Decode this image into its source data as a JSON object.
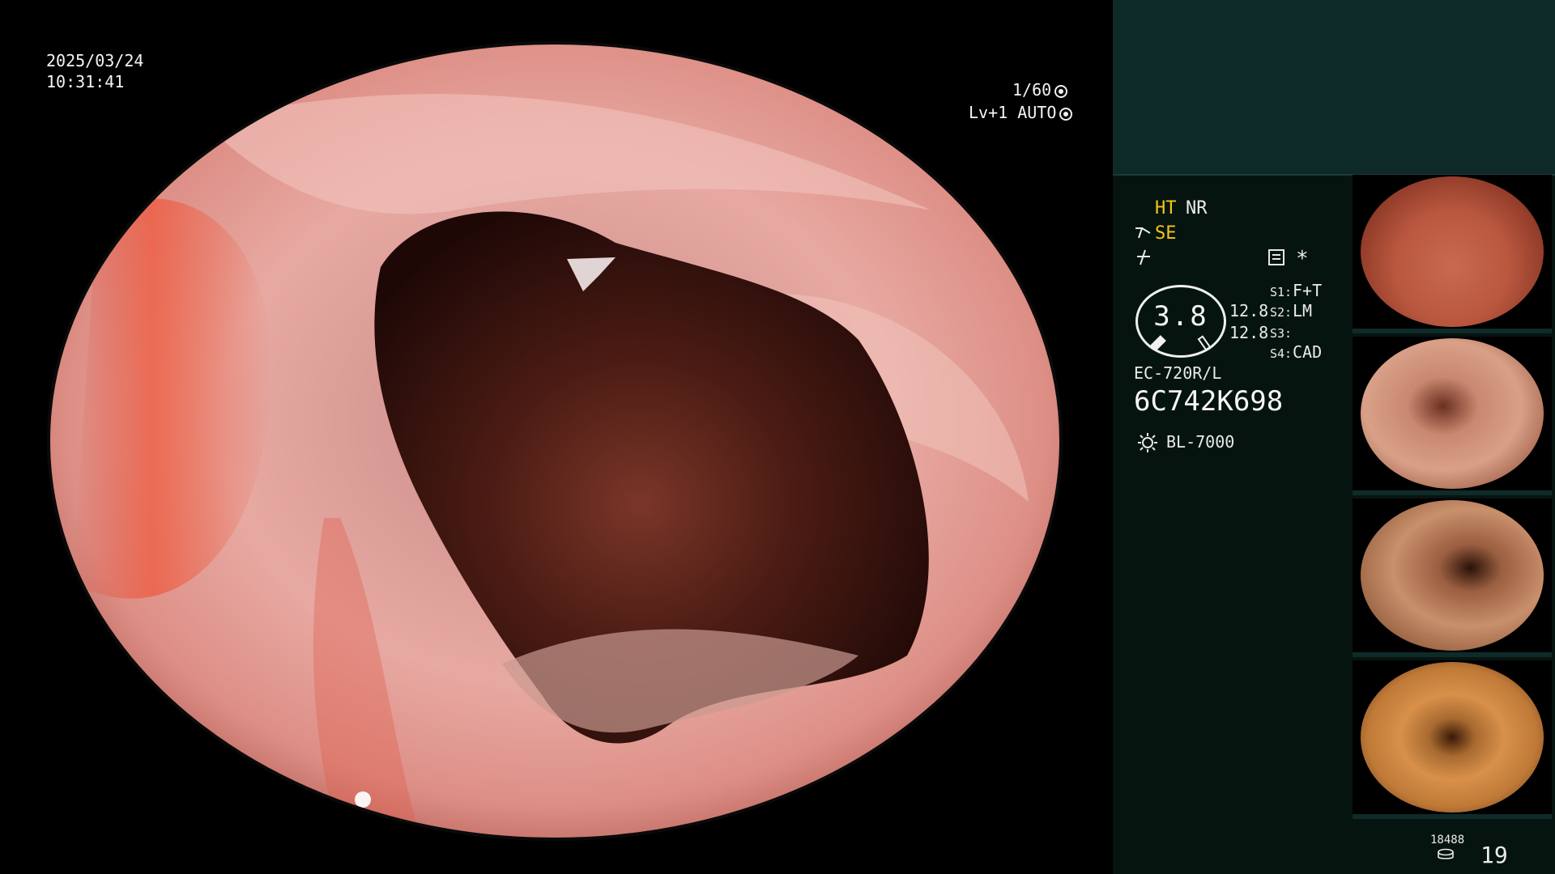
{
  "osd": {
    "date": "2025/03/24",
    "time": "10:31:41",
    "shutter": "1/60",
    "level": "Lv+1 AUTO"
  },
  "panel": {
    "ht": "HT",
    "nr": "NR",
    "se": "SE",
    "star": "*",
    "gauge_value": "3.8",
    "value_1": "12.8",
    "value_2": "12.8",
    "settings": [
      {
        "label": "S1:",
        "value": "F+T"
      },
      {
        "label": "S2:",
        "value": "LM"
      },
      {
        "label": "S3:",
        "value": ""
      },
      {
        "label": "S4:",
        "value": "CAD"
      }
    ],
    "scope_model": "EC-720R/L",
    "scope_serial": "6C742K698",
    "light_source": "BL-7000",
    "storage_count": "18488",
    "image_count": "19"
  },
  "colors": {
    "accent_yellow": "#f5c518",
    "panel_top": "#0e2a28",
    "panel_bg": "#061410"
  },
  "icons": [
    "shutter-icon",
    "auto-iris-icon",
    "se-mode-icon",
    "structure-icon",
    "menu-icon",
    "light-source-icon",
    "storage-icon"
  ]
}
